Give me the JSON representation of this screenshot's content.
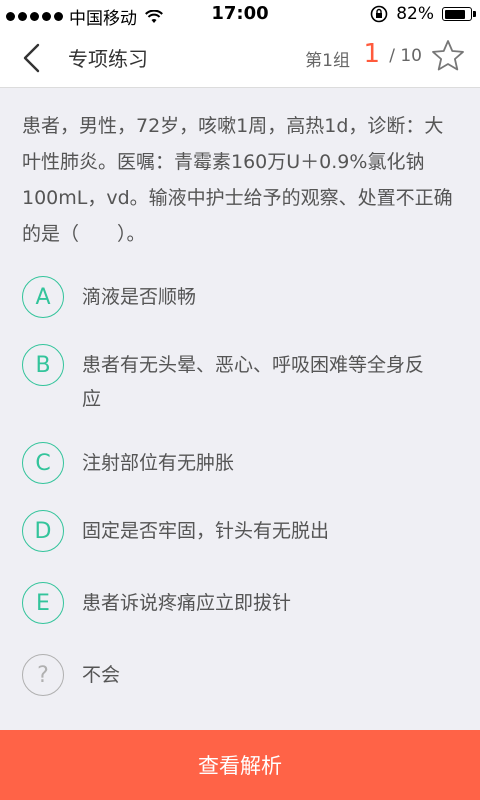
{
  "status_bar": {
    "carrier": "中国移动",
    "time": "17:00",
    "battery": "82%",
    "battery_level": 0.82
  },
  "nav": {
    "title": "专项练习",
    "group": "第1组",
    "current": "1",
    "total": "/ 10"
  },
  "question": {
    "text": "患者，男性，72岁，咳嗽1周，高热1d，诊断：大叶性肺炎。医嘱：青霉素160万U＋0.9%氯化钠100mL，vd。输液中护士给予的观察、处置不正确的是（　　）。"
  },
  "options": [
    {
      "letter": "A",
      "text": "滴液是否顺畅"
    },
    {
      "letter": "B",
      "text": "患者有无头晕、恶心、呼吸困难等全身反应"
    },
    {
      "letter": "C",
      "text": "注射部位有无肿胀"
    },
    {
      "letter": "D",
      "text": "固定是否牢固，针头有无脱出"
    },
    {
      "letter": "E",
      "text": "患者诉说疼痛应立即拔针"
    },
    {
      "letter": "?",
      "text": "不会"
    }
  ],
  "bottom": {
    "button_label": "查看解析"
  },
  "colors": {
    "accent": "#33c49b",
    "highlight": "#ff5a3c",
    "button": "#ff6347"
  }
}
